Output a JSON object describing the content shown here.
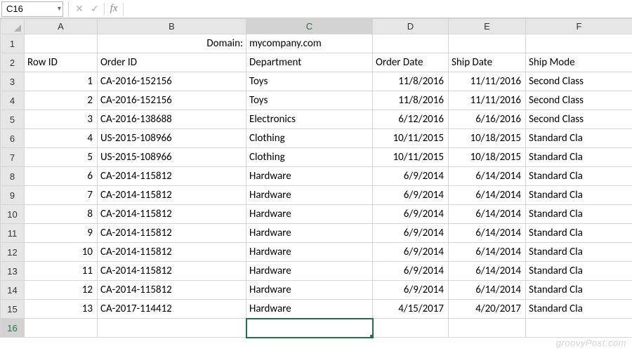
{
  "formula_bar": {
    "name_box": "C16",
    "cancel_glyph": "✕",
    "confirm_glyph": "✓",
    "fx_glyph": "fx",
    "formula_value": ""
  },
  "columns": [
    "A",
    "B",
    "C",
    "D",
    "E",
    "F"
  ],
  "active_cell": {
    "col": "C",
    "row": 16
  },
  "row1": {
    "B_label": "Domain:",
    "C_value": "mycompany.com"
  },
  "headers": {
    "A": "Row ID",
    "B": "Order ID",
    "C": "Department",
    "D": "Order Date",
    "E": "Ship Date",
    "F": "Ship Mode"
  },
  "rows": [
    {
      "n": 3,
      "row_id": "1",
      "order_id": "CA-2016-152156",
      "dept": "Toys",
      "order_date": "11/8/2016",
      "ship_date": "11/11/2016",
      "ship_mode": "Second Class"
    },
    {
      "n": 4,
      "row_id": "2",
      "order_id": "CA-2016-152156",
      "dept": "Toys",
      "order_date": "11/8/2016",
      "ship_date": "11/11/2016",
      "ship_mode": "Second Class"
    },
    {
      "n": 5,
      "row_id": "3",
      "order_id": "CA-2016-138688",
      "dept": "Electronics",
      "order_date": "6/12/2016",
      "ship_date": "6/16/2016",
      "ship_mode": "Second Class"
    },
    {
      "n": 6,
      "row_id": "4",
      "order_id": "US-2015-108966",
      "dept": "Clothing",
      "order_date": "10/11/2015",
      "ship_date": "10/18/2015",
      "ship_mode": "Standard Cla"
    },
    {
      "n": 7,
      "row_id": "5",
      "order_id": "US-2015-108966",
      "dept": "Clothing",
      "order_date": "10/11/2015",
      "ship_date": "10/18/2015",
      "ship_mode": "Standard Cla"
    },
    {
      "n": 8,
      "row_id": "6",
      "order_id": "CA-2014-115812",
      "dept": "Hardware",
      "order_date": "6/9/2014",
      "ship_date": "6/14/2014",
      "ship_mode": "Standard Cla"
    },
    {
      "n": 9,
      "row_id": "7",
      "order_id": "CA-2014-115812",
      "dept": "Hardware",
      "order_date": "6/9/2014",
      "ship_date": "6/14/2014",
      "ship_mode": "Standard Cla"
    },
    {
      "n": 10,
      "row_id": "8",
      "order_id": "CA-2014-115812",
      "dept": "Hardware",
      "order_date": "6/9/2014",
      "ship_date": "6/14/2014",
      "ship_mode": "Standard Cla"
    },
    {
      "n": 11,
      "row_id": "9",
      "order_id": "CA-2014-115812",
      "dept": "Hardware",
      "order_date": "6/9/2014",
      "ship_date": "6/14/2014",
      "ship_mode": "Standard Cla"
    },
    {
      "n": 12,
      "row_id": "10",
      "order_id": "CA-2014-115812",
      "dept": "Hardware",
      "order_date": "6/9/2014",
      "ship_date": "6/14/2014",
      "ship_mode": "Standard Cla"
    },
    {
      "n": 13,
      "row_id": "11",
      "order_id": "CA-2014-115812",
      "dept": "Hardware",
      "order_date": "6/9/2014",
      "ship_date": "6/14/2014",
      "ship_mode": "Standard Cla"
    },
    {
      "n": 14,
      "row_id": "12",
      "order_id": "CA-2014-115812",
      "dept": "Hardware",
      "order_date": "6/9/2014",
      "ship_date": "6/14/2014",
      "ship_mode": "Standard Cla"
    },
    {
      "n": 15,
      "row_id": "13",
      "order_id": "CA-2017-114412",
      "dept": "Hardware",
      "order_date": "4/15/2017",
      "ship_date": "4/20/2017",
      "ship_mode": "Standard Cla"
    }
  ],
  "watermark": "groovyPost.com"
}
